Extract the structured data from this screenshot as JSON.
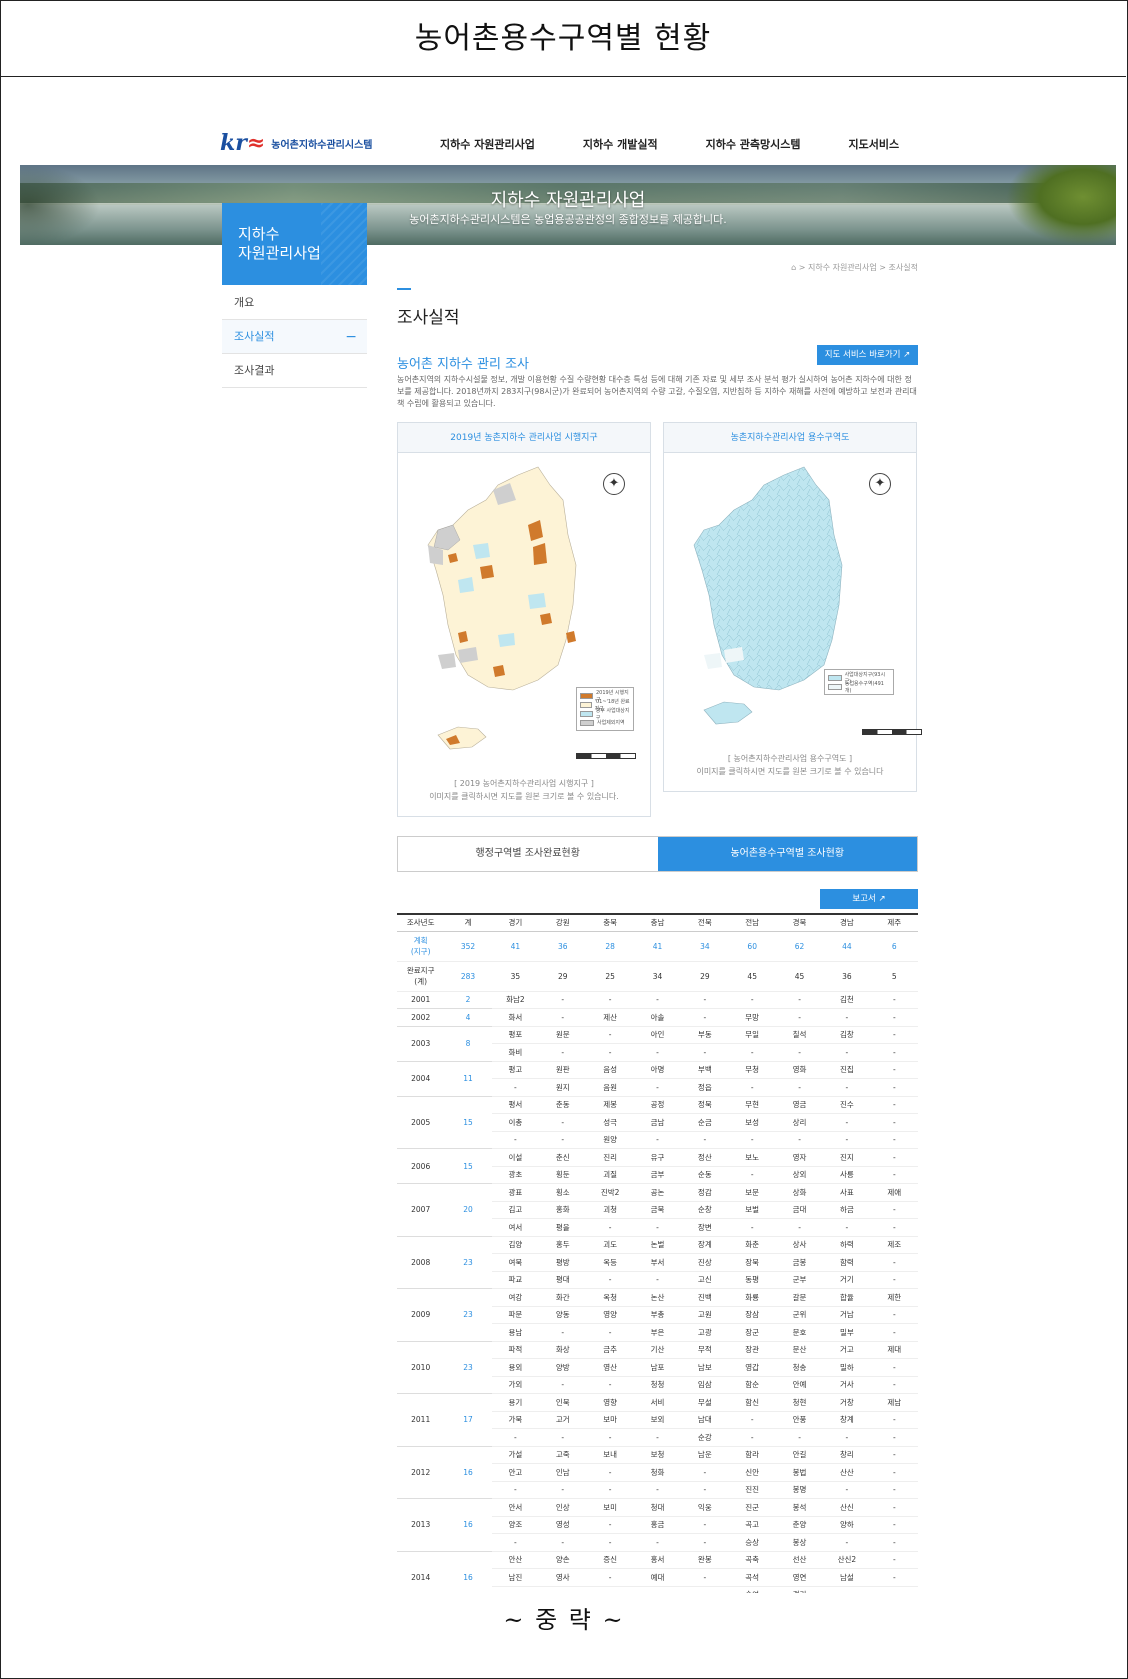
{
  "doc_title": "농어촌용수구역별 현황",
  "footer_note": "~ 중 략 ~",
  "logo": {
    "mark": "kr",
    "name": "농어촌지하수관리시스템"
  },
  "gnb": [
    "지하수 자원관리사업",
    "지하수 개발실적",
    "지하수 관측망시스템",
    "지도서비스"
  ],
  "banner": {
    "title": "지하수 자원관리사업",
    "subtitle": "농어촌지하수관리시스템은 농업용공공관정의 종합정보를 제공합니다."
  },
  "lnb": {
    "title": "지하수\n자원관리사업",
    "items": [
      "개요",
      "조사실적",
      "조사결과"
    ],
    "active_minus": "−"
  },
  "breadcrumb": "⌂ > 지하수 자원관리사업 > 조사실적",
  "page_title": "조사실적",
  "section_title": "농어촌 지하수 관리 조사",
  "map_button": "지도 서비스 바로가기 ↗",
  "description": "농어촌지역의 지하수시설물 정보, 개발 이용현황 수질 수량현황 대수층 특성 등에 대해 기존 자료 및 세부 조사 분석 평가 실시하여 농어촌 지하수에 대한 정보를 제공합니다. 2018년까지 283지구(98시군)가 완료되어 농어촌지역의 수량 고갈, 수질오염, 지반침하 등 지하수 재해를 사전에 예방하고 보전과 관리대책 수립에 활용되고 있습니다.",
  "panels": [
    {
      "title": "2019년 농촌지하수 관리사업 시행지구",
      "caption1": "[ 2019 농어촌지하수관리사업 시행지구 ]",
      "caption2": "이미지를 클릭하시면 지도를 원본 크기로 볼 수 있습니다.",
      "legend": [
        "2019년 시행지구",
        "'01~'18년 완료지구",
        "향후 사업대상지구",
        "사업제외지역"
      ]
    },
    {
      "title": "농촌지하수관리사업 용수구역도",
      "caption1": "[ 농어촌지하수관리사업 용수구역도 ]",
      "caption2": "이미지를 클릭하시면 지도를 원본 크기로 볼 수 있습니다",
      "legend": [
        "사업대상지구(93시군)",
        "농업용수구역(491개)"
      ]
    }
  ],
  "tabs": [
    "행정구역별 조사완료현황",
    "농어촌용수구역별 조사현황"
  ],
  "report_button": "보고서 ↗",
  "table": {
    "headers": [
      "조사년도",
      "계",
      "경기",
      "강원",
      "충북",
      "충남",
      "전북",
      "전남",
      "경북",
      "경남",
      "제주"
    ],
    "plan": {
      "label": "계획\n(지구)",
      "values": [
        "352",
        "41",
        "36",
        "28",
        "41",
        "34",
        "60",
        "62",
        "44",
        "6"
      ]
    },
    "done": {
      "label": "완료지구\n(계)",
      "values": [
        "283",
        "35",
        "29",
        "25",
        "34",
        "29",
        "45",
        "45",
        "36",
        "5"
      ]
    },
    "years": [
      {
        "year": "2001",
        "total": "2",
        "rows": [
          [
            "화남2",
            "-",
            "-",
            "-",
            "-",
            "-",
            "-",
            "김천",
            "-"
          ]
        ]
      },
      {
        "year": "2002",
        "total": "4",
        "rows": [
          [
            "화서",
            "-",
            "제산",
            "아솔",
            "-",
            "무망",
            "-",
            "-",
            "-"
          ]
        ]
      },
      {
        "year": "2003",
        "total": "8",
        "rows": [
          [
            "평포",
            "원문",
            "-",
            "아인",
            "부동",
            "무일",
            "칠석",
            "김창",
            "-"
          ],
          [
            "화비",
            "-",
            "-",
            "-",
            "-",
            "-",
            "-",
            "-",
            "-"
          ]
        ]
      },
      {
        "year": "2004",
        "total": "11",
        "rows": [
          [
            "평고",
            "원판",
            "음성",
            "아명",
            "부백",
            "무청",
            "영화",
            "진집",
            "-"
          ],
          [
            "-",
            "원지",
            "음원",
            "-",
            "정읍",
            "-",
            "-",
            "-",
            "-"
          ]
        ]
      },
      {
        "year": "2005",
        "total": "15",
        "rows": [
          [
            "평서",
            "춘동",
            "제봉",
            "공정",
            "정북",
            "무현",
            "영금",
            "진수",
            "-"
          ],
          [
            "이총",
            "-",
            "성극",
            "금남",
            "순금",
            "보성",
            "상리",
            "-",
            "-"
          ],
          [
            "-",
            "-",
            "원양",
            "-",
            "-",
            "-",
            "-",
            "-",
            "-"
          ]
        ]
      },
      {
        "year": "2006",
        "total": "15",
        "rows": [
          [
            "이설",
            "춘신",
            "진리",
            "유구",
            "정산",
            "보노",
            "영자",
            "진지",
            "-"
          ],
          [
            "광초",
            "횡둔",
            "괴질",
            "금부",
            "순동",
            "-",
            "상외",
            "사릉",
            "-"
          ]
        ]
      },
      {
        "year": "2007",
        "total": "20",
        "rows": [
          [
            "광표",
            "횡소",
            "진박2",
            "공논",
            "정감",
            "보문",
            "상화",
            "사표",
            "제애"
          ],
          [
            "김고",
            "홍화",
            "괴청",
            "금북",
            "순창",
            "보벌",
            "금대",
            "하금",
            "-"
          ],
          [
            "여서",
            "평을",
            "-",
            "-",
            "장변",
            "-",
            "-",
            "-",
            "-"
          ]
        ]
      },
      {
        "year": "2008",
        "total": "23",
        "rows": [
          [
            "김양",
            "홍두",
            "괴도",
            "논벌",
            "장계",
            "화춘",
            "상사",
            "하력",
            "제조"
          ],
          [
            "여북",
            "평방",
            "옥등",
            "부서",
            "진상",
            "장북",
            "금봉",
            "함력",
            "-"
          ],
          [
            "파교",
            "평대",
            "-",
            "-",
            "고신",
            "동평",
            "군부",
            "거기",
            "-"
          ]
        ]
      },
      {
        "year": "2009",
        "total": "23",
        "rows": [
          [
            "여강",
            "화간",
            "옥청",
            "논산",
            "진백",
            "화룡",
            "갈문",
            "합율",
            "제한"
          ],
          [
            "파문",
            "양동",
            "영양",
            "부총",
            "고원",
            "장삼",
            "군위",
            "거남",
            "-"
          ],
          [
            "용남",
            "-",
            "-",
            "부은",
            "고광",
            "장군",
            "문호",
            "밀부",
            "-"
          ]
        ]
      },
      {
        "year": "2010",
        "total": "23",
        "rows": [
          [
            "파적",
            "화상",
            "금추",
            "기산",
            "무적",
            "장관",
            "문산",
            "거고",
            "제대"
          ],
          [
            "용외",
            "양방",
            "영산",
            "남포",
            "남보",
            "영갑",
            "청송",
            "밀하",
            "-"
          ],
          [
            "가외",
            "-",
            "-",
            "청청",
            "임삼",
            "함순",
            "안예",
            "거사",
            "-"
          ]
        ]
      },
      {
        "year": "2011",
        "total": "17",
        "rows": [
          [
            "용기",
            "인북",
            "영향",
            "서비",
            "무설",
            "함신",
            "청현",
            "거창",
            "제남"
          ],
          [
            "가북",
            "고거",
            "보마",
            "보외",
            "남대",
            "-",
            "안풍",
            "창계",
            "-"
          ],
          [
            "-",
            "-",
            "-",
            "-",
            "순강",
            "-",
            "-",
            "-",
            "-"
          ]
        ]
      },
      {
        "year": "2012",
        "total": "16",
        "rows": [
          [
            "가설",
            "고죽",
            "보내",
            "보청",
            "남운",
            "함라",
            "안길",
            "창리",
            "-"
          ],
          [
            "안고",
            "인남",
            "-",
            "청화",
            "-",
            "신안",
            "봉법",
            "산산",
            "-"
          ],
          [
            "-",
            "-",
            "-",
            "-",
            "-",
            "진진",
            "봉명",
            "-",
            "-"
          ]
        ]
      },
      {
        "year": "2013",
        "total": "16",
        "rows": [
          [
            "안서",
            "인상",
            "보미",
            "청대",
            "익웅",
            "진군",
            "봉석",
            "산신",
            "-"
          ],
          [
            "양조",
            "영성",
            "-",
            "홍금",
            "-",
            "곡고",
            "춘양",
            "양하",
            "-"
          ],
          [
            "-",
            "-",
            "-",
            "-",
            "-",
            "승상",
            "봉상",
            "-",
            "-"
          ]
        ]
      },
      {
        "year": "2014",
        "total": "16",
        "rows": [
          [
            "안산",
            "양손",
            "증신",
            "홍서",
            "완봉",
            "곡축",
            "선산",
            "산신2",
            "-"
          ],
          [
            "남진",
            "영사",
            "-",
            "예대",
            "-",
            "곡석",
            "영연",
            "남설",
            "-"
          ],
          [
            "-",
            "-",
            "-",
            "-",
            "-",
            "승여",
            "경기",
            "-",
            "-"
          ]
        ]
      }
    ]
  },
  "colors": {
    "accent": "#2c8fe0",
    "sea_blue": "#bfe6f0",
    "land": "#fdf3d6",
    "done": "#d07a2c",
    "excluded": "#cfcfcf"
  }
}
